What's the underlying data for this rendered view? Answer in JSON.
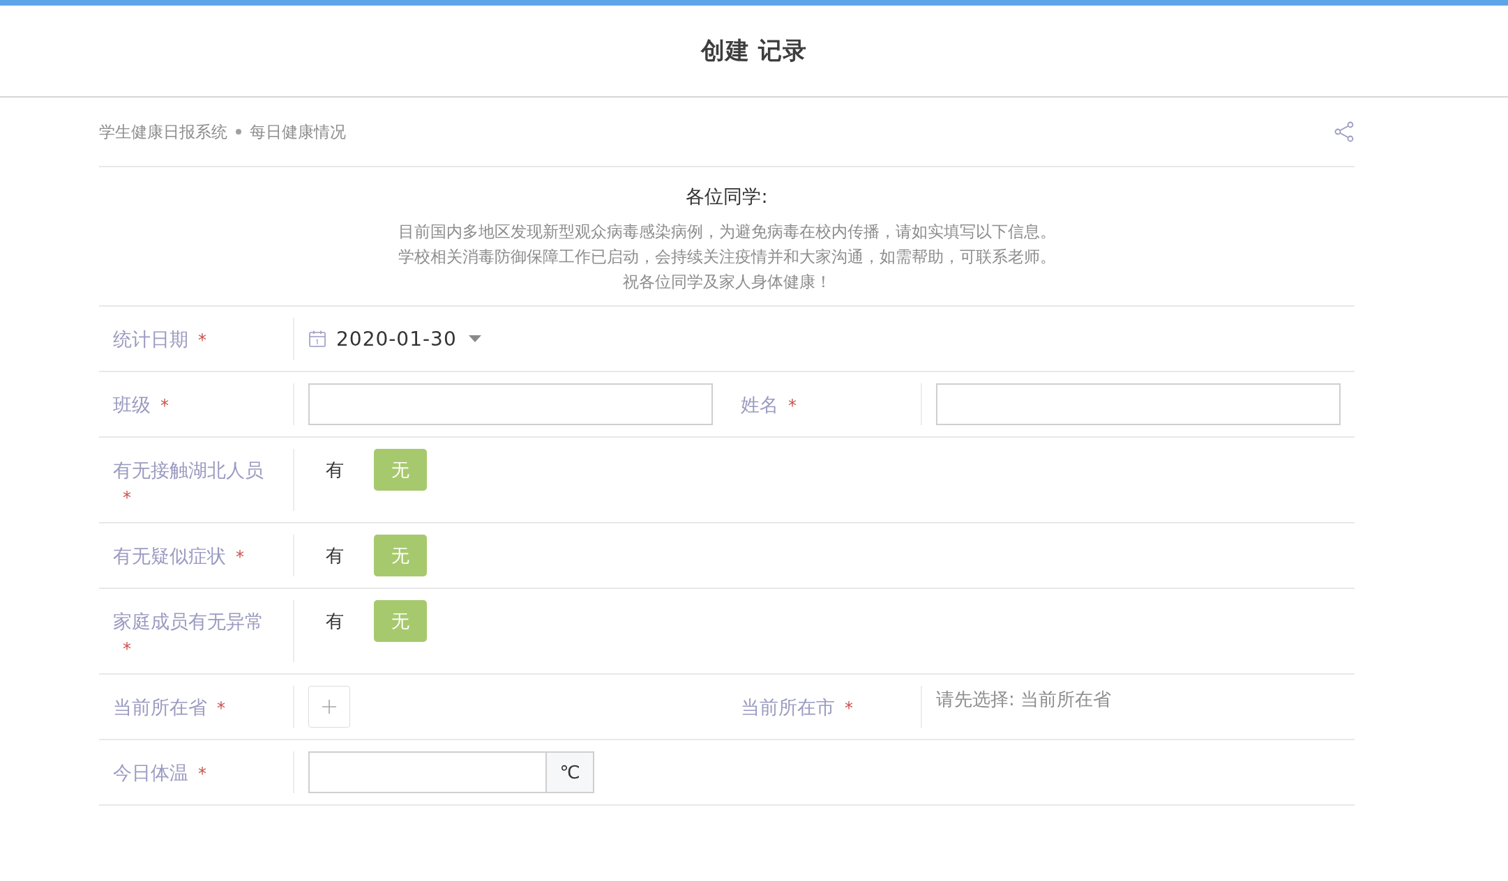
{
  "header": {
    "title": "创建 记录"
  },
  "breadcrumb": {
    "items": [
      "学生健康日报系统",
      "每日健康情况"
    ]
  },
  "intro": {
    "heading": "各位同学:",
    "lines": [
      "目前国内多地区发现新型观众病毒感染病例，为避免病毒在校内传播，请如实填写以下信息。",
      "学校相关消毒防御保障工作已启动，会持续关注疫情并和大家沟通，如需帮助，可联系老师。",
      "祝各位同学及家人身体健康！"
    ]
  },
  "rows": [
    {
      "fields": [
        {
          "kind": "date",
          "label": "统计日期",
          "mark": "*",
          "value": "2020-01-30"
        }
      ]
    },
    {
      "fields": [
        {
          "kind": "text",
          "label": "班级",
          "mark": "*"
        },
        {
          "kind": "text",
          "label": "姓名",
          "mark": "*"
        }
      ]
    },
    {
      "fields": [
        {
          "kind": "choice",
          "label": "有无接触湖北人员",
          "mark": "*",
          "options": [
            {
              "label": "有",
              "selected": false
            },
            {
              "label": "无",
              "selected": true
            }
          ]
        }
      ]
    },
    {
      "fields": [
        {
          "kind": "choice",
          "label": "有无疑似症状",
          "mark": "*",
          "options": [
            {
              "label": "有",
              "selected": false
            },
            {
              "label": "无",
              "selected": true
            }
          ]
        }
      ]
    },
    {
      "fields": [
        {
          "kind": "choice",
          "label": "家庭成员有无异常",
          "mark": "*",
          "options": [
            {
              "label": "有",
              "selected": false
            },
            {
              "label": "无",
              "selected": true
            }
          ]
        }
      ]
    },
    {
      "fields": [
        {
          "kind": "picker",
          "label": "当前所在省",
          "mark": "*"
        },
        {
          "kind": "hint",
          "label": "当前所在市",
          "mark": "*",
          "hint": "请先选择: 当前所在省"
        }
      ]
    },
    {
      "fields": [
        {
          "kind": "unit",
          "label": "今日体温",
          "mark": "*",
          "unit": "℃"
        }
      ]
    }
  ]
}
